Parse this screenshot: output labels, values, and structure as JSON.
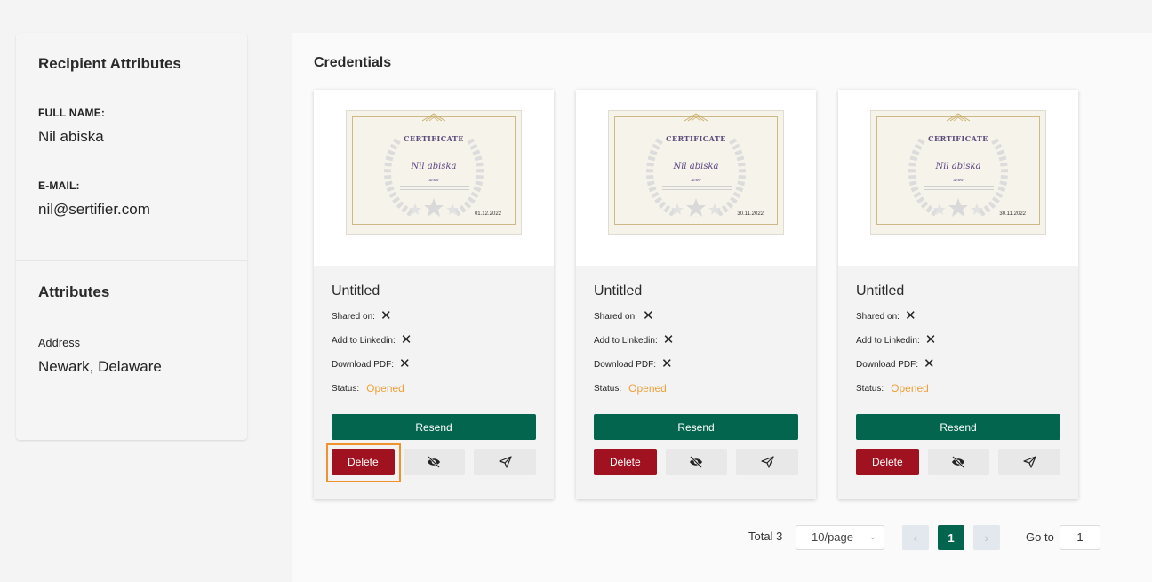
{
  "recipient": {
    "title": "Recipient Attributes",
    "full_name_label": "FULL NAME:",
    "full_name": "Nil abiska",
    "email_label": "E-MAIL:",
    "email": "nil@sertifier.com"
  },
  "attributes": {
    "title": "Attributes",
    "address_label": "Address",
    "address": "Newark, Delaware"
  },
  "credentials": {
    "title": "Credentials",
    "cards": [
      {
        "title": "Untitled",
        "cert_title": "CERTIFICATE",
        "cert_name": "Nil abiska",
        "cert_org": "Acnw",
        "cert_date": "01.12.2022",
        "shared_label": "Shared on:",
        "linkedin_label": "Add to Linkedin:",
        "pdf_label": "Download PDF:",
        "status_label": "Status:",
        "status_value": "Opened",
        "resend": "Resend",
        "delete": "Delete"
      },
      {
        "title": "Untitled",
        "cert_title": "CERTIFICATE",
        "cert_name": "Nil abiska",
        "cert_org": "Acnw",
        "cert_date": "30.11.2022",
        "shared_label": "Shared on:",
        "linkedin_label": "Add to Linkedin:",
        "pdf_label": "Download PDF:",
        "status_label": "Status:",
        "status_value": "Opened",
        "resend": "Resend",
        "delete": "Delete"
      },
      {
        "title": "Untitled",
        "cert_title": "CERTIFICATE",
        "cert_name": "Nil abiska",
        "cert_org": "Acnw",
        "cert_date": "30.11.2022",
        "shared_label": "Shared on:",
        "linkedin_label": "Add to Linkedin:",
        "pdf_label": "Download PDF:",
        "status_label": "Status:",
        "status_value": "Opened",
        "resend": "Resend",
        "delete": "Delete"
      }
    ]
  },
  "pagination": {
    "total": "Total 3",
    "page_size": "10/page",
    "current_page": "1",
    "goto_label": "Go to",
    "goto_value": "1"
  },
  "colors": {
    "primary_green": "#03654e",
    "delete_red": "#a0121f",
    "status_orange": "#f0a03a",
    "highlight_orange": "#f0922e"
  },
  "icons": {
    "not_shared": "close-icon",
    "hide": "eye-off-icon",
    "send": "send-icon",
    "prev": "chevron-left-icon",
    "next": "chevron-right-icon",
    "dropdown": "chevron-down-icon"
  }
}
